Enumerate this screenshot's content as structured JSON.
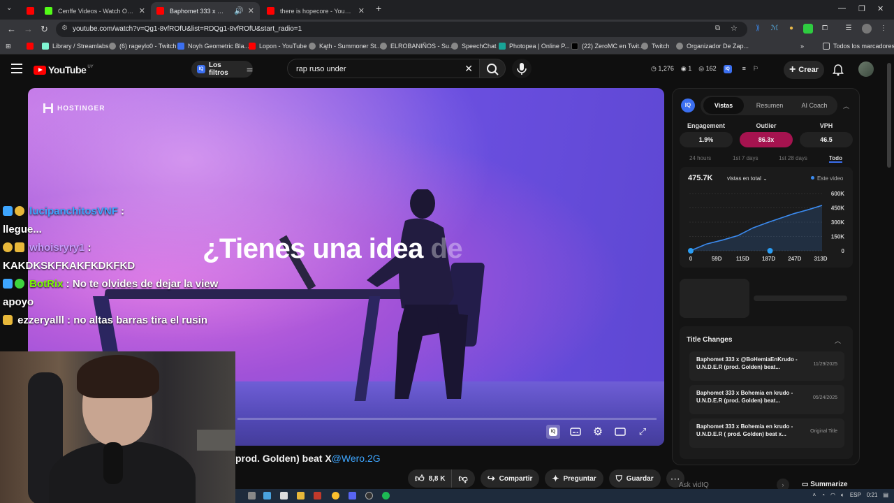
{
  "browser": {
    "tabs": [
      {
        "title": "Cenffe Videos - Watch On-Dem",
        "favicon": "kick-icon"
      },
      {
        "title": "Baphomet 333 x @BoHemi",
        "favicon": "youtube-icon",
        "active": true
      },
      {
        "title": "there is hopecore - YouTube",
        "favicon": "youtube-icon"
      }
    ],
    "url": "youtube.com/watch?v=Qg1-8vfROfU&list=RDQg1-8vfROfU&start_radio=1",
    "bookmarks": [
      "Library / Streamlabs",
      "(6) rageylo0 - Twitch",
      "Noyh Geometric Bla...",
      "Lopon - YouTube",
      "Kąth - Summoner St...",
      "ELROBANIÑOS - Su...",
      "SpeechChat",
      "Photopea | Online P...",
      "(22) ZeroMC en Twit...",
      "Twitch",
      "Organizador De Zap..."
    ],
    "all_bookmarks": "Todos los marcadores"
  },
  "youtube": {
    "logo": "YouTube",
    "country": "UY",
    "filters_label": "Los filtros",
    "search_query": "rap ruso under",
    "header_stats": {
      "views": "1,276",
      "a": "1",
      "b": "162"
    },
    "create_label": "Crear"
  },
  "player": {
    "ad_brand": "HOSTINGER",
    "ad_headline_main": "¿Tienes una idea",
    "ad_headline_fade": "de"
  },
  "chat": [
    {
      "user": "lucipanchitosVNF",
      "user_color": "#3ea6ff",
      "message": "llegue..."
    },
    {
      "user": "whoisryry1",
      "user_color": "#c79bff",
      "message": "KAKDKSKFKAKFKDKFKD"
    },
    {
      "user": "BotRix",
      "user_color": "#7cfc00",
      "message": "No te olvides de dejar la view apoyo"
    },
    {
      "user": "ezzeryalll",
      "user_color": "#ffffff",
      "message": "no altas barras tira el rusin"
    }
  ],
  "video": {
    "title_visible": "prod. Golden) beat X",
    "title_mention": "@Wero.2G",
    "likes": "8,8 K",
    "share_label": "Compartir",
    "ask_label": "Preguntar",
    "save_label": "Guardar"
  },
  "vidiq": {
    "tabs": [
      "Vistas",
      "Resumen",
      "AI Coach"
    ],
    "metrics": [
      {
        "label": "Engagement",
        "value": "1.9%"
      },
      {
        "label": "Outlier",
        "value": "86.3x"
      },
      {
        "label": "VPH",
        "value": "46.5"
      }
    ],
    "ranges": [
      "24 hours",
      "1st 7 days",
      "1st 28 days",
      "Todo"
    ],
    "total": "475.7K",
    "total_dropdown": "vistas en total",
    "legend": "Este video",
    "title_changes_heading": "Title Changes",
    "title_changes": [
      {
        "title": "Baphomet 333 x @BoHemiaEnKrudo - U.N.D.E.R (prod. Golden) beat...",
        "date": "11/29/2025"
      },
      {
        "title": "Baphomet 333 x Bohemia en krudo - U.N.D.E.R (prod. Golden) beat...",
        "date": "05/24/2025"
      },
      {
        "title": "Baphomet 333 x Bohemia en krudo - U.N.D.E.R ( prod. Golden) beat x...",
        "date": "Original Title"
      }
    ],
    "ask_placeholder": "Ask vidIQ",
    "summarize_label": "Summarize"
  },
  "chart_data": {
    "type": "line",
    "x_ticks": [
      "0",
      "59D",
      "115D",
      "187D",
      "247D",
      "313D"
    ],
    "y_ticks": [
      "600K",
      "450K",
      "300K",
      "150K",
      "0"
    ],
    "series": [
      {
        "x": [
          0,
          10,
          40,
          80,
          115,
          150,
          187,
          220,
          247,
          280,
          313
        ],
        "y": [
          0,
          15000,
          70000,
          115000,
          160000,
          240000,
          300000,
          350000,
          390000,
          430000,
          475700
        ]
      }
    ],
    "ylim": [
      0,
      600000
    ],
    "xlim": [
      0,
      313
    ],
    "markers_at_x": [
      0,
      187
    ],
    "grid": true
  },
  "taskbar": {
    "lang": "ESP",
    "time": "0:21"
  }
}
